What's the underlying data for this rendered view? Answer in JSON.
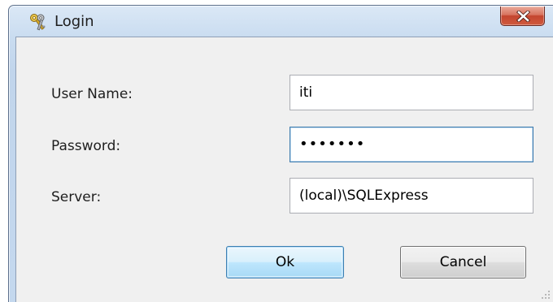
{
  "window": {
    "title": "Login",
    "icon": "keys-icon",
    "close_glyph": "close-icon"
  },
  "form": {
    "username_label": "User Name:",
    "username_value": "iti",
    "password_label": "Password:",
    "password_value": "•••••••",
    "server_label": "Server:",
    "server_value": "(local)\\SQLExpress"
  },
  "buttons": {
    "ok_label": "Ok",
    "cancel_label": "Cancel"
  },
  "colors": {
    "close_button": "#c4452f",
    "focus_border": "#3d7bad",
    "default_button_border": "#3c7fb1"
  }
}
